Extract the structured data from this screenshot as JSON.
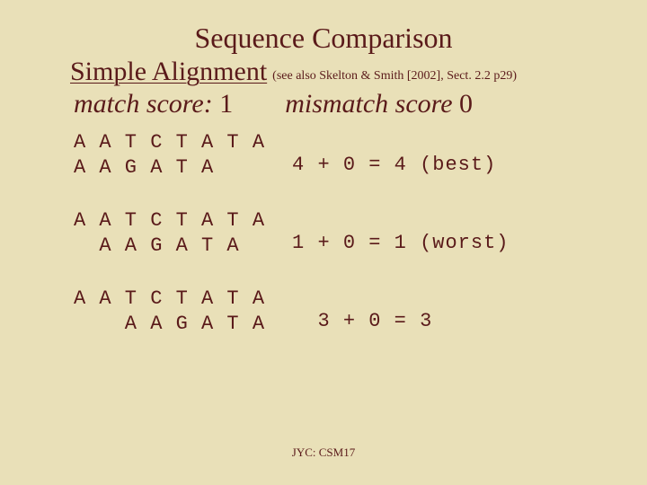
{
  "title": "Sequence Comparison",
  "subtitle": "Simple Alignment",
  "reference": "(see also Skelton & Smith [2002], Sect. 2.2 p29)",
  "match_label": "match score",
  "match_value": "1",
  "mismatch_label": "mismatch score",
  "mismatch_value": "0",
  "blocks": [
    {
      "seq1": "A A T C T A T A",
      "seq2": "A A G A T A",
      "result": "4 + 0 = 4 (best)"
    },
    {
      "seq1": "A A T C T A T A",
      "seq2": "  A A G A T A",
      "result": "1 + 0 = 1 (worst)"
    },
    {
      "seq1": "A A T C T A T A",
      "seq2": "    A A G A T A",
      "result": "  3 + 0 = 3"
    }
  ],
  "footer": "JYC: CSM17"
}
